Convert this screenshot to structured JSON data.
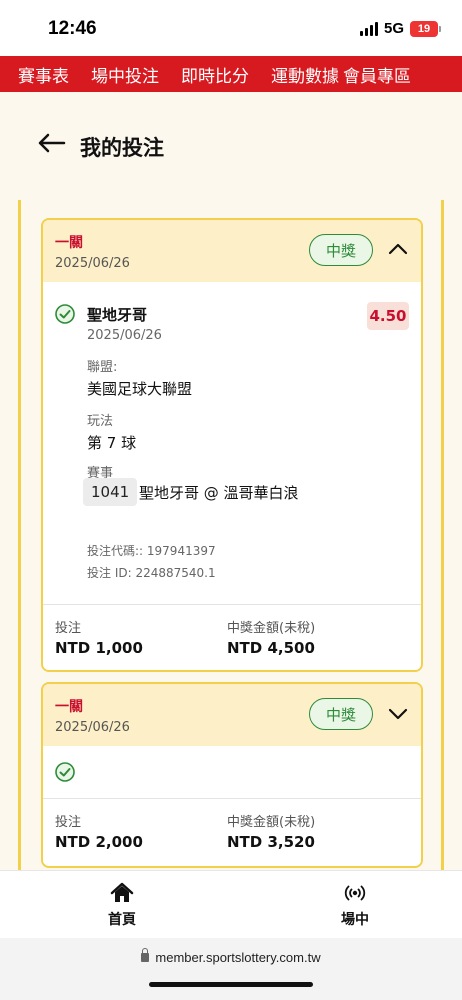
{
  "status_bar": {
    "time": "12:46",
    "network": "5G",
    "battery": "19"
  },
  "top_nav": {
    "items": [
      "賽事表",
      "場中投注",
      "即時比分",
      "運動數據",
      "會員專區"
    ]
  },
  "header": {
    "title": "我的投注"
  },
  "bets": [
    {
      "type": "一關",
      "date": "2025/06/26",
      "status": "中獎",
      "expanded": true,
      "selection": {
        "team": "聖地牙哥",
        "date": "2025/06/26",
        "odds": "4.50",
        "league_label": "聯盟:",
        "league": "美國足球大聯盟",
        "play_label": "玩法",
        "play": "第 7 球",
        "event_label": "賽事",
        "event_id": "1041",
        "event_name": "聖地牙哥 @ 溫哥華白浪",
        "bet_code": "投注代碼:: 197941397",
        "bet_id": "投注 ID: 224887540.1"
      },
      "stake_label": "投注",
      "stake": "NTD 1,000",
      "payout_label": "中獎金額(未稅)",
      "payout": "NTD 4,500"
    },
    {
      "type": "一關",
      "date": "2025/06/26",
      "status": "中獎",
      "expanded": false,
      "stake_label": "投注",
      "stake": "NTD 2,000",
      "payout_label": "中獎金額(未稅)",
      "payout": "NTD 3,520"
    }
  ],
  "tab_bar": {
    "home": "首頁",
    "live": "場中"
  },
  "browser": {
    "url": "member.sportslottery.com.tw"
  },
  "colors": {
    "brand_red": "#d71920",
    "accent_yellow": "#f2d04a",
    "win_green": "#2e8b3a"
  }
}
